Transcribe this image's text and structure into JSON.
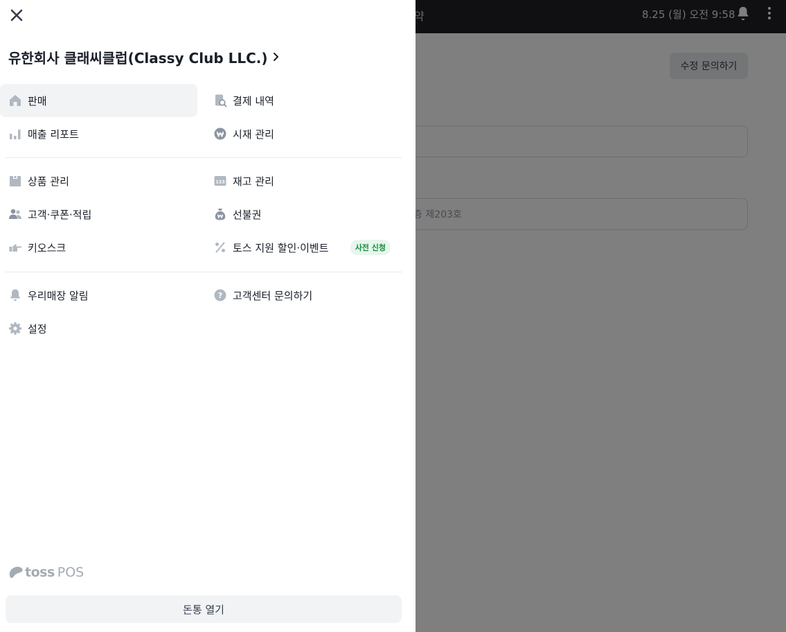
{
  "background": {
    "topbar_title": "약",
    "datetime": "8.25 (월) 오전 9:58",
    "edit_button": "수정 문의하기",
    "field1_value": "",
    "field2_value": "층 제203호"
  },
  "drawer": {
    "store_name": "유한회사 클래씨클럽(Classy Club LLC.)",
    "menu": {
      "sales": "판매",
      "payment_history": "결제 내역",
      "sales_report": "매출 리포트",
      "market_price": "시재 관리",
      "products": "상품 관리",
      "inventory": "재고 관리",
      "customers": "고객·쿠폰·적립",
      "gift_card": "선불권",
      "kiosk": "키오스크",
      "toss_discount": "토스 지원 할인·이벤트",
      "toss_discount_badge": "사전 신청",
      "store_alerts": "우리매장 알림",
      "support": "고객센터 문의하기",
      "settings": "설정"
    },
    "logo": {
      "brand": "toss",
      "product": "POS"
    },
    "open_cash_drawer": "돈통 열기"
  },
  "colors": {
    "accent_badge_bg": "#e7f6ec",
    "accent_badge_text": "#168a3f",
    "icon_gray": "#b0b8c1",
    "topbar_bg": "#202124"
  }
}
